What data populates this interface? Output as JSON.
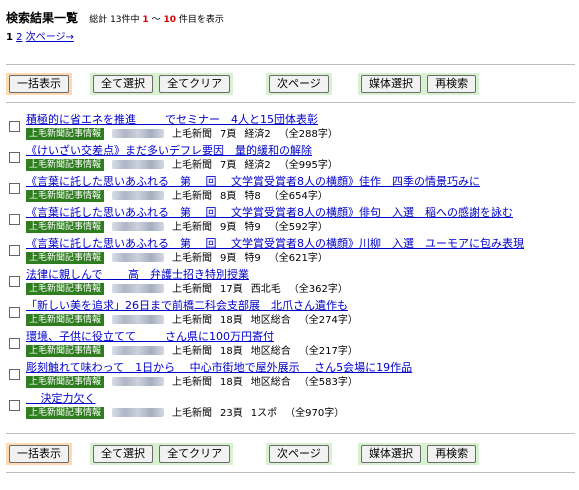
{
  "header": {
    "title": "検索結果一覧",
    "summary_prefix": "総計 13件中",
    "range_start": "1",
    "range_sep": "～",
    "range_end": "10",
    "summary_suffix": "件目を表示"
  },
  "pager": {
    "current": "1",
    "page2": "2",
    "next": "次ページ→"
  },
  "toolbar": {
    "show_all": "一括表示",
    "select_all": "全て選択",
    "clear_all": "全てクリア",
    "next_page": "次ページ",
    "media_select": "媒体選択",
    "research": "再検索"
  },
  "badge_label": "上毛新聞記事情報",
  "results": [
    {
      "title": "積極的に省エネを推進 　　 でセミナー　4人と15団体表彰",
      "source": "上毛新聞",
      "page": "7頁",
      "section": "経済2",
      "chars": "（全288字）"
    },
    {
      "title": "《けいざい交差点》まだ多いデフレ要因　量的緩和の解除",
      "source": "上毛新聞",
      "page": "7頁",
      "section": "経済2",
      "chars": "（全995字）"
    },
    {
      "title": "《言葉に託した思いあふれる　第　 回 　文学賞受賞者8人の横顔》佳作　四季の情景巧みに",
      "source": "上毛新聞",
      "page": "8頁",
      "section": "特8",
      "chars": "（全654字）"
    },
    {
      "title": "《言葉に託した思いあふれる　第　 回 　文学賞受賞者8人の横顔》俳句　入選　稲への感謝を詠む",
      "source": "上毛新聞",
      "page": "9頁",
      "section": "特9",
      "chars": "（全592字）"
    },
    {
      "title": "《言葉に託した思いあふれる　第　 回 　文学賞受賞者8人の横顔》川柳　入選　ユーモアに包み表現",
      "source": "上毛新聞",
      "page": "9頁",
      "section": "特9",
      "chars": "（全621字）"
    },
    {
      "title": "法律に親しんで　　 高　弁護士招き特別授業",
      "source": "上毛新聞",
      "page": "17頁",
      "section": "西北毛",
      "chars": "（全362字）"
    },
    {
      "title": "「新しい美を追求」26日まで前橋二科会支部展　北爪さん遺作も",
      "source": "上毛新聞",
      "page": "18頁",
      "section": "地区総合",
      "chars": "（全274字）"
    },
    {
      "title": "環境、子供に役立てて　 　 さん県に100万円寄付",
      "source": "上毛新聞",
      "page": "18頁",
      "section": "地区総合",
      "chars": "（全217字）"
    },
    {
      "title": "彫刻触れて味わって　1日から　 中心市街地で屋外展示　 さん5会場に19作品",
      "source": "上毛新聞",
      "page": "18頁",
      "section": "地区総合",
      "chars": "（全583字）"
    },
    {
      "title": "　 決定力欠く",
      "source": "上毛新聞",
      "page": "23頁",
      "section": "1スポ",
      "chars": "（全970字）"
    }
  ]
}
